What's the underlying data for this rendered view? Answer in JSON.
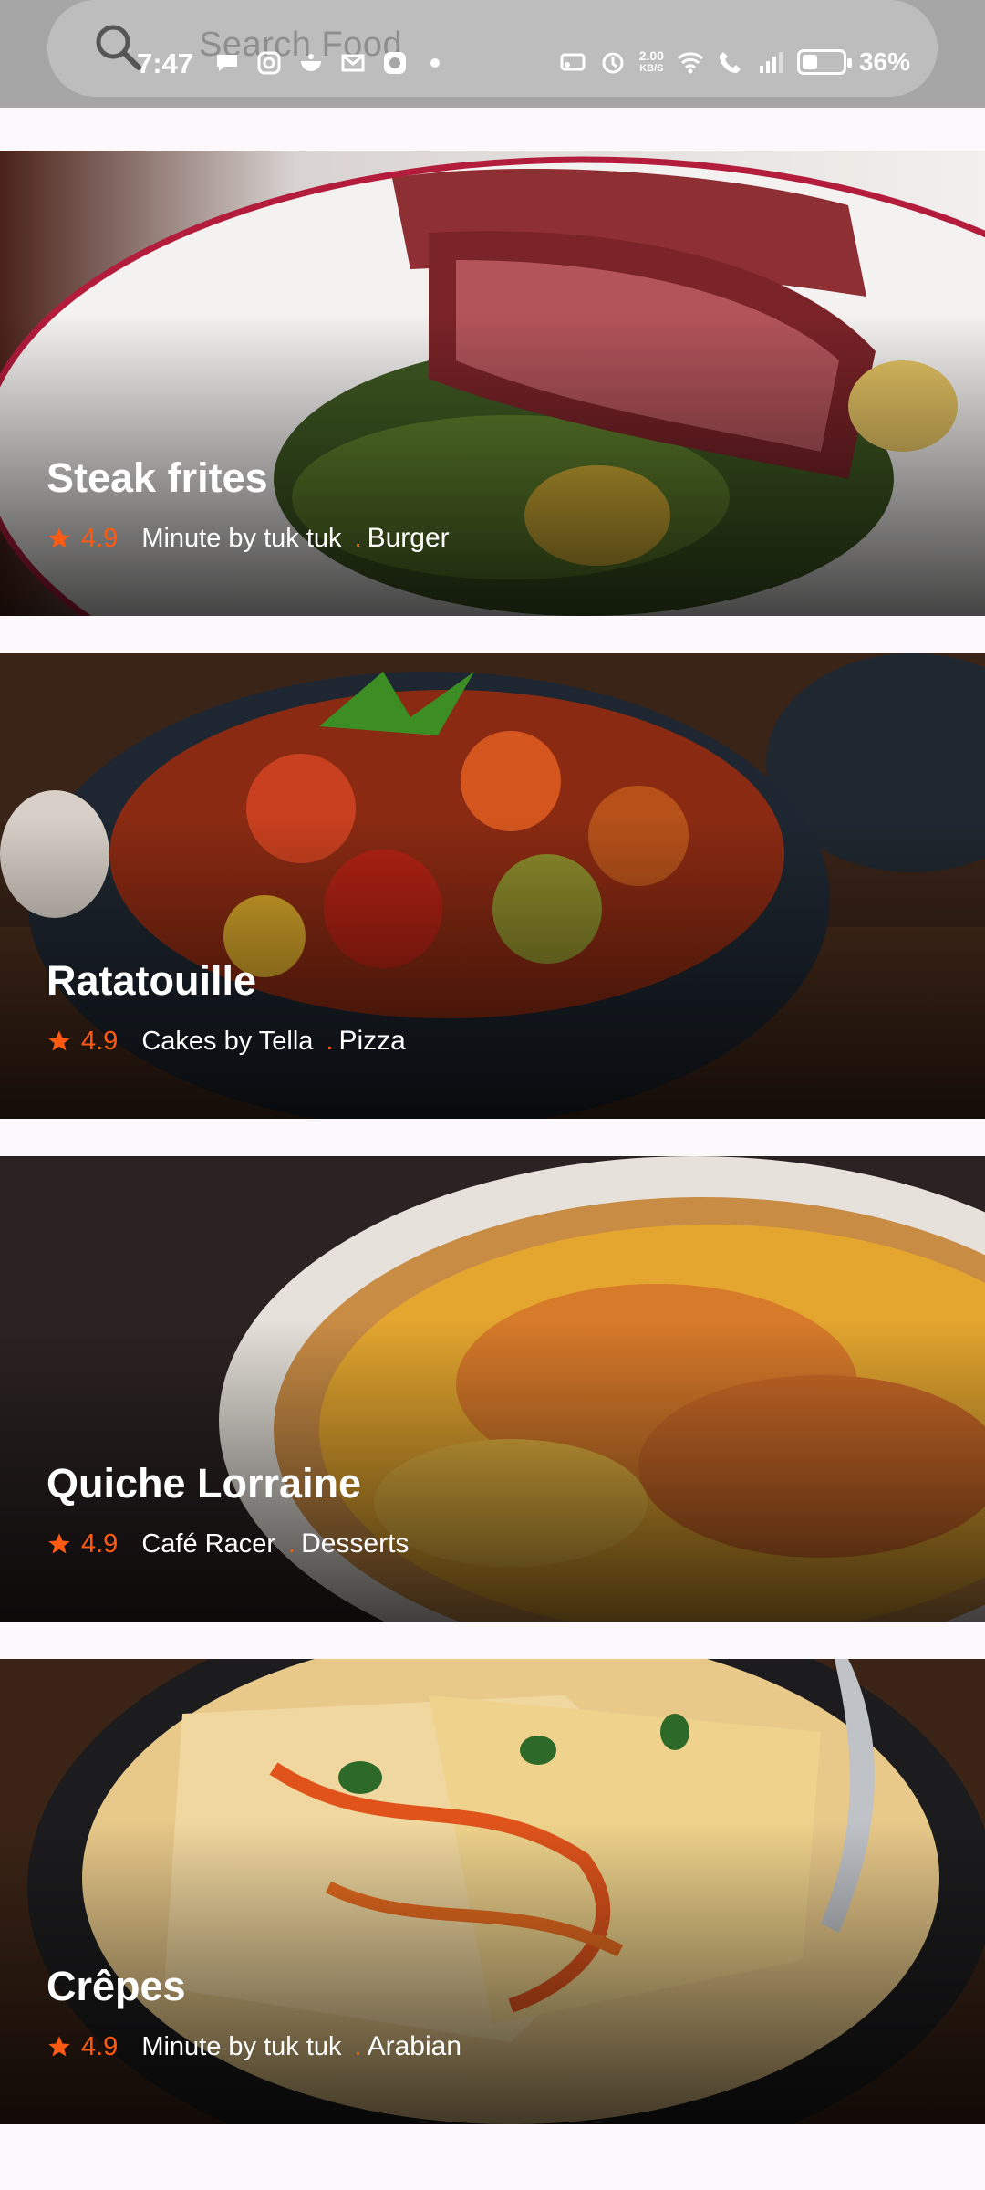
{
  "status_bar": {
    "time": "7:47",
    "network_speed_value": "2.00",
    "network_speed_unit": "KB/S",
    "battery_percent": "36%",
    "battery_level": 0.36
  },
  "search": {
    "placeholder": "Search Food"
  },
  "foods": [
    {
      "title": "Steak frites",
      "rating": "4.9",
      "restaurant": "Minute by tuk tuk",
      "separator": ".",
      "category": "Burger"
    },
    {
      "title": "Ratatouille",
      "rating": "4.9",
      "restaurant": "Cakes by Tella",
      "separator": ".",
      "category": "Pizza"
    },
    {
      "title": "Quiche Lorraine",
      "rating": "4.9",
      "restaurant": "Café Racer",
      "separator": ".",
      "category": "Desserts"
    },
    {
      "title": "Crêpes",
      "rating": "4.9",
      "restaurant": "Minute by tuk tuk",
      "separator": ".",
      "category": "Arabian"
    }
  ],
  "colors": {
    "accent": "#ff5a12",
    "page_background": "#fcf8fb",
    "search_bar": "#bdbdbd"
  },
  "icons": [
    "search-icon",
    "star-icon",
    "wifi-icon",
    "battery-icon",
    "alarm-icon",
    "signal-icon"
  ]
}
